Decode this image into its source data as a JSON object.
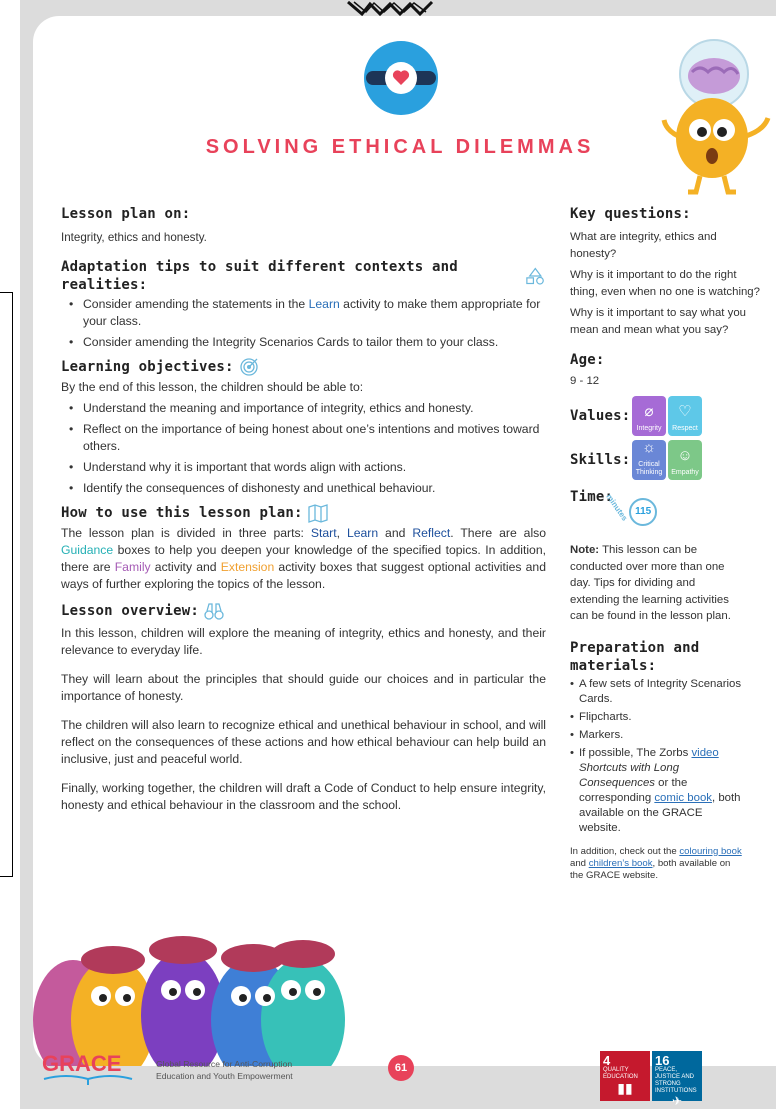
{
  "title": "SOLVING ETHICAL DILEMMAS",
  "lesson_plan_on": {
    "heading": "Lesson plan on:",
    "text": "Integrity, ethics and honesty."
  },
  "adaptation": {
    "heading": "Adaptation tips to suit different contexts and realities:",
    "items": [
      {
        "pre": "Consider amending the statements in the ",
        "hl": "Learn",
        "post": " activity to make them appropriate for your class."
      },
      {
        "pre": "Consider amending the Integrity Scenarios Cards to tailor them to your class.",
        "hl": "",
        "post": ""
      }
    ]
  },
  "objectives": {
    "heading": "Learning objectives:",
    "intro": "By the end of this lesson, the children should be able to:",
    "items": [
      "Understand the meaning and importance of integrity, ethics and honesty.",
      "Reflect on the importance of being honest about one’s intentions and motives toward others.",
      "Understand why it is important that words align with actions.",
      "Identify the consequences of dishonesty and unethical behaviour."
    ]
  },
  "how_to_use": {
    "heading": "How to use this lesson plan:",
    "t1": "The lesson plan is divided in three parts: ",
    "start": "Start",
    "comma": ", ",
    "learn": "Learn",
    "and": " and ",
    "reflect": "Reflect",
    "t2": ". There are also ",
    "guidance": "Guidance",
    "t3": " boxes to help you deepen your knowledge of the specified topics. In addition, there are ",
    "family": "Family",
    "t4": " activity and ",
    "extension": "Extension",
    "t5": " activity boxes that suggest optional activities and ways of further exploring the topics of the lesson."
  },
  "overview": {
    "heading": "Lesson overview:",
    "paragraphs": [
      "In this lesson, children will explore the meaning of integrity, ethics and honesty, and their relevance to everyday life.",
      "They will learn about the principles that should guide our choices and in particular the importance of honesty.",
      " The children will also learn to recognize ethical and unethical behaviour in school, and will reflect on the consequences of these actions and how ethical behaviour can help build an inclusive, just and peaceful world.",
      "Finally, working together, the children will draft a Code of Conduct to help ensure integrity, honesty and ethical behaviour in the classroom and the school."
    ]
  },
  "key_questions": {
    "heading": "Key questions:",
    "items": [
      "What are integrity, ethics and honesty?",
      "Why is it important to do the right thing, even when no one is watching?",
      "Why is it important to say what you mean and mean what you say?"
    ]
  },
  "age": {
    "heading": "Age:",
    "value": "9 - 12"
  },
  "values": {
    "heading": "Values:",
    "badges": [
      "Integrity",
      "Respect"
    ]
  },
  "skills": {
    "heading": "Skills:",
    "badges": [
      "Critical Thinking",
      "Empathy"
    ]
  },
  "time": {
    "heading": "Time:",
    "unit": "minutes",
    "value": "115"
  },
  "note": {
    "label": "Note:",
    "text": " This lesson can be conducted over more than one day. Tips for dividing and extending the learning activities can be found in the lesson plan."
  },
  "preparation": {
    "heading": "Preparation and materials:",
    "items": [
      "A few sets of Integrity Scenarios Cards.",
      "Flipcharts.",
      "Markers."
    ],
    "last": {
      "t1": "If possible, The Zorbs ",
      "video": "video",
      "t2": " ",
      "italic": "Shortcuts with Long Consequences",
      "t3": " or the corresponding ",
      "comic": "comic book",
      "t4": ", both available on the GRACE website."
    }
  },
  "addition": {
    "t1": "In addition, check out the ",
    "colouring": "colouring book",
    "t2": " and ",
    "childrens": "children’s book",
    "t3": ", both available on the GRACE website."
  },
  "footer": {
    "logo": "GRACE",
    "tagline_1": "Global Resource for Anti-Corruption",
    "tagline_2": "Education and Youth Empowerment",
    "page_number": "61",
    "sdg4_num": "4",
    "sdg4_label": "QUALITY EDUCATION",
    "sdg16_num": "16",
    "sdg16_label": "PEACE, JUSTICE AND STRONG INSTITUTIONS"
  },
  "colors": {
    "title_red": "#e8425a",
    "badge_blue": "#2aa0de",
    "integrity_purple": "#a66bd6",
    "respect_teal": "#5ec8e8",
    "critical_blue": "#6a87d6",
    "empathy_green": "#7dc888",
    "sdg4_red": "#c5192d",
    "sdg16_blue": "#00689d"
  }
}
